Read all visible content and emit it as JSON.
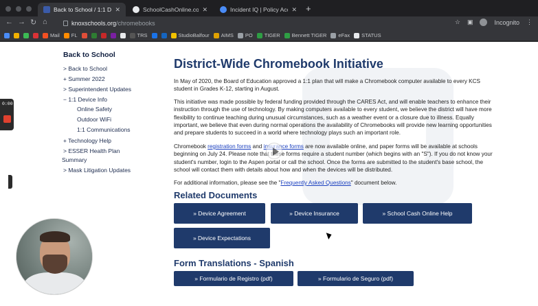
{
  "browser": {
    "tabs": [
      {
        "title": "Back to School / 1:1 Device Info",
        "favicon_color": "#3b5ba9",
        "active": true
      },
      {
        "title": "SchoolCashOnline.com: Welc",
        "favicon_color": "#e8eaed",
        "active": false
      },
      {
        "title": "Incident IQ | Policy Acceptanc",
        "favicon_color": "#4a8cf7",
        "active": false
      }
    ],
    "address": {
      "host": "knoxschools.org",
      "path": "/chromebooks"
    },
    "profile_label": "Incognito",
    "bookmarks": [
      {
        "label": "",
        "color": "#4a8cf7"
      },
      {
        "label": "",
        "color": "#f2b100"
      },
      {
        "label": "",
        "color": "#3cba54"
      },
      {
        "label": "",
        "color": "#db3236"
      },
      {
        "label": "Mail",
        "color": "#f25022"
      },
      {
        "label": "FL",
        "color": "#ff8c00"
      },
      {
        "label": "",
        "color": "#e04e39"
      },
      {
        "label": "",
        "color": "#2e7d32"
      },
      {
        "label": "",
        "color": "#c62828"
      },
      {
        "label": "",
        "color": "#7b1fa2"
      },
      {
        "label": "",
        "color": "#e8eaed"
      },
      {
        "label": "TRS",
        "color": "#555"
      },
      {
        "label": "",
        "color": "#1a73e8"
      },
      {
        "label": "",
        "color": "#1565c0"
      },
      {
        "label": "StudioBalfour",
        "color": "#f2c200"
      },
      {
        "label": "AIMS",
        "color": "#e0a100"
      },
      {
        "label": "PO",
        "color": "#9aa0a6"
      },
      {
        "label": "TIGER",
        "color": "#2e9e44"
      },
      {
        "label": "Bennett TIGER",
        "color": "#2e9e44"
      },
      {
        "label": "eFax",
        "color": "#9aa0a6"
      },
      {
        "label": "STATUS",
        "color": "#e8eaed"
      }
    ]
  },
  "sidebar": {
    "title": "Back to School",
    "items": [
      {
        "label": "> Back to School"
      },
      {
        "label": "+ Summer 2022"
      },
      {
        "label": "> Superintendent Updates"
      },
      {
        "label": "− 1:1 Device Info"
      },
      {
        "label": "Online Safety"
      },
      {
        "label": "Outdoor WiFi"
      },
      {
        "label": "1:1 Communications"
      },
      {
        "label": "+ Technology Help"
      },
      {
        "label": "> ESSER Health Plan"
      },
      {
        "label": "Summary"
      },
      {
        "label": "> Mask Litigation Updates"
      }
    ]
  },
  "main": {
    "title": "District-Wide Chromebook Initiative",
    "p1": "In May of 2020, the Board of Education approved a 1:1 plan that will make a Chromebook computer available to every KCS student in Grades K-12, starting in August.",
    "p2": "This initiative was made possible by federal funding provided through the CARES Act, and will enable teachers to enhance their instruction through the use of technology. By making computers available to every student, we believe the district will have more flexibility to continue teaching during unusual circumstances, such as a weather event or a closure due to illness. Equally important, we believe that even during normal operations the availability of Chromebooks will provide new learning opportunities and prepare students to succeed in a world where technology plays such an important role.",
    "p3": {
      "a": "Chromebook ",
      "link1": "registration forms",
      "b": " and ",
      "link2": "insurance forms",
      "c": " are now available online, and paper forms will be available at schools beginning on July 24. Please note that these forms require a student number (which begins with an \"S\"). If you do not know your student's number, login to the Aspen portal or call the school. Once the forms are submitted to the student's base school, the school will contact them with details about how and when the devices will be distributed."
    },
    "p4": {
      "a": "For additional information, please see the \"",
      "link": "Frequently Asked Questions",
      "b": "\" document below."
    },
    "related_heading": "Related Documents",
    "related_buttons": [
      "» Device Agreement",
      "» Device Insurance",
      "» School Cash Online Help",
      "» Device Expectations"
    ],
    "spanish_heading": "Form Translations - Spanish",
    "spanish_buttons": [
      "» Formulario de Registro (pdf)",
      "» Formulario de Seguro (pdf)"
    ]
  },
  "recorder": {
    "time": "0:00"
  }
}
